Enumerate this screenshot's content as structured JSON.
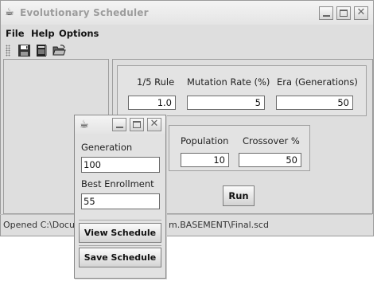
{
  "main_window": {
    "title": "Evolutionary Scheduler",
    "menu": [
      "File",
      "Help",
      "Options"
    ],
    "toolbar_icons": [
      "save-icon",
      "book-icon",
      "open-folder-icon"
    ],
    "status_text": "Opened C:\\Docu",
    "status_text_tail": "m.BASEMENT\\Final.scd"
  },
  "settings": {
    "group1": {
      "one_fifth_rule": {
        "label": "1/5 Rule",
        "value": "1.0"
      },
      "mutation_rate": {
        "label": "Mutation Rate (%)",
        "value": "5"
      },
      "era": {
        "label": "Era (Generations)",
        "value": "50"
      }
    },
    "group2": {
      "population": {
        "label": "Population",
        "value": "10"
      },
      "crossover": {
        "label": "Crossover %",
        "value": "50"
      }
    },
    "run_label": "Run"
  },
  "popup": {
    "generation": {
      "label": "Generation",
      "value": "100"
    },
    "best_enrollment": {
      "label": "Best Enrollment",
      "value": "55"
    },
    "view_label": "View Schedule",
    "save_label": "Save Schedule"
  },
  "colors": {
    "window_bg": "#dedede",
    "title_text": "#9c9c9c",
    "field_bg": "#ffffff"
  }
}
